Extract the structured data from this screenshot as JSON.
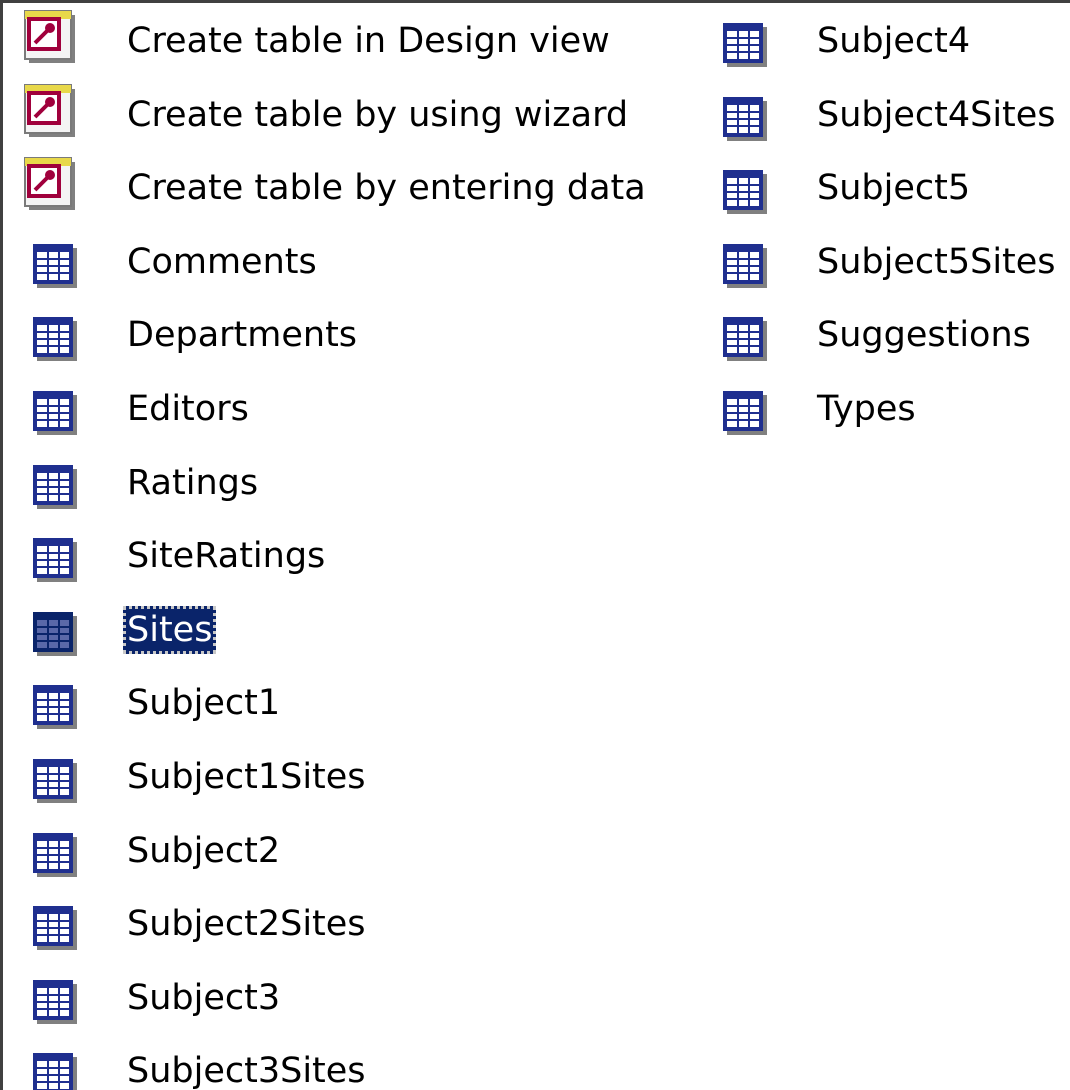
{
  "left_column": [
    {
      "label": "Create table in Design view",
      "icon": "shortcut-icon",
      "kind": "shortcut"
    },
    {
      "label": "Create table by using wizard",
      "icon": "shortcut-icon",
      "kind": "shortcut"
    },
    {
      "label": "Create table by entering data",
      "icon": "shortcut-icon",
      "kind": "shortcut"
    },
    {
      "label": "Comments",
      "icon": "table-icon",
      "kind": "table"
    },
    {
      "label": "Departments",
      "icon": "table-icon",
      "kind": "table"
    },
    {
      "label": "Editors",
      "icon": "table-icon",
      "kind": "table"
    },
    {
      "label": "Ratings",
      "icon": "table-icon",
      "kind": "table"
    },
    {
      "label": "SiteRatings",
      "icon": "table-icon",
      "kind": "table"
    },
    {
      "label": "Sites",
      "icon": "table-icon",
      "kind": "table",
      "selected": true
    },
    {
      "label": "Subject1",
      "icon": "table-icon",
      "kind": "table"
    },
    {
      "label": "Subject1Sites",
      "icon": "table-icon",
      "kind": "table"
    },
    {
      "label": "Subject2",
      "icon": "table-icon",
      "kind": "table"
    },
    {
      "label": "Subject2Sites",
      "icon": "table-icon",
      "kind": "table"
    },
    {
      "label": "Subject3",
      "icon": "table-icon",
      "kind": "table"
    },
    {
      "label": "Subject3Sites",
      "icon": "table-icon",
      "kind": "table"
    }
  ],
  "right_column": [
    {
      "label": "Subject4",
      "icon": "table-icon",
      "kind": "table"
    },
    {
      "label": "Subject4Sites",
      "icon": "table-icon",
      "kind": "table"
    },
    {
      "label": "Subject5",
      "icon": "table-icon",
      "kind": "table"
    },
    {
      "label": "Subject5Sites",
      "icon": "table-icon",
      "kind": "table"
    },
    {
      "label": "Suggestions",
      "icon": "table-icon",
      "kind": "table"
    },
    {
      "label": "Types",
      "icon": "table-icon",
      "kind": "table"
    }
  ],
  "colors": {
    "selection": "#0a246a",
    "table_frame": "#1f2f8f",
    "shortcut_accent": "#a0003c"
  }
}
